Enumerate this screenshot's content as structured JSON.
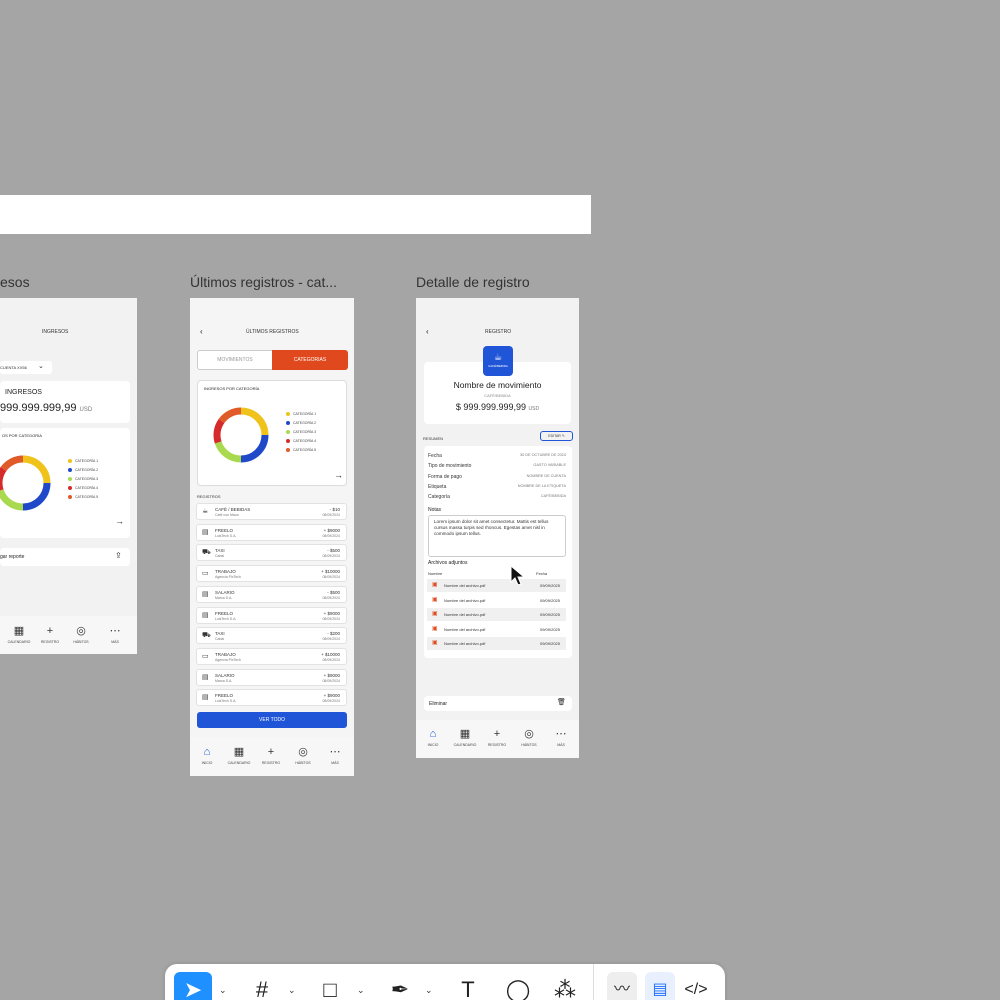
{
  "canvas": {
    "bg": "#a5a5a5"
  },
  "frames": {
    "f1": {
      "title": "esos",
      "header": "INGRESOS",
      "account": "CUENTA XX56",
      "summary_label": "INGRESOS",
      "amount": "999.999.999,99",
      "currency": "USD",
      "chart_title": "OS POR CATEGORIA",
      "legend": [
        "CATEGORÍA 1",
        "CATEGORÍA 2",
        "CATEGORÍA 3",
        "CATEGORÍA 4",
        "CATEGORÍA 5"
      ],
      "export": "gar reporte",
      "nav": [
        "CALENDARIO",
        "REGISTRO",
        "HÁBITOS",
        "MÁS"
      ]
    },
    "f2": {
      "title": "Últimos registros - cat...",
      "header": "ÚLTIMOS REGISTROS",
      "tabs": [
        "MOVIMIENTOS",
        "CATEGORIAS"
      ],
      "chart_title": "INGRESOS POR CATEGORÍA",
      "legend": [
        "CATEGORÍA 1",
        "CATEGORÍA 2",
        "CATEGORÍA 3",
        "CATEGORÍA 4",
        "CATEGORÍA 5"
      ],
      "section": "REGISTROS",
      "rows": [
        {
          "icon": "☕",
          "name": "CAFÉ / BEBIDAS",
          "sub": "Café con Maca",
          "amount": "- $10",
          "date": "08/09/2024"
        },
        {
          "icon": "▤",
          "name": "FREELO",
          "sub": "LuisTech S.A.",
          "amount": "+ $9000",
          "date": "08/09/2024"
        },
        {
          "icon": "⛟",
          "name": "TAXI",
          "sub": "Cabai",
          "amount": "- $500",
          "date": "08/09/2024"
        },
        {
          "icon": "▭",
          "name": "TRABAJO",
          "sub": "Agencia PixTech",
          "amount": "+ $10000",
          "date": "08/09/2024"
        },
        {
          "icon": "▤",
          "name": "SALARIO",
          "sub": "Marca S.A.",
          "amount": "- $500",
          "date": "08/09/2024"
        },
        {
          "icon": "▤",
          "name": "FREELO",
          "sub": "LuisTech S.A.",
          "amount": "+ $9000",
          "date": "08/09/2024"
        },
        {
          "icon": "⛟",
          "name": "TAXI",
          "sub": "Cabai",
          "amount": "- $200",
          "date": "08/09/2024"
        },
        {
          "icon": "▭",
          "name": "TRABAJO",
          "sub": "Agencia PixTech",
          "amount": "+ $10000",
          "date": "08/09/2024"
        },
        {
          "icon": "▤",
          "name": "SALARIO",
          "sub": "Marca S.A.",
          "amount": "+ $9000",
          "date": "08/09/2024"
        },
        {
          "icon": "▤",
          "name": "FREELO",
          "sub": "LuisTech S.A.",
          "amount": "+ $9000",
          "date": "08/09/2024"
        }
      ],
      "cta": "VER TODO",
      "nav": [
        "INICIO",
        "CALENDARIO",
        "REGISTRO",
        "HÁBITOS",
        "MÁS"
      ]
    },
    "f3": {
      "title": "Detalle de registro",
      "header": "REGISTRO",
      "badge": "CAFÉ/BEBIDA",
      "name": "Nombre de movimiento",
      "category": "CAFÉ/BEBIDA",
      "amount": "$ 999.999.999,99",
      "currency": "USD",
      "section": "RESUMEN",
      "edit": "EDITAR",
      "details": [
        {
          "label": "Fecha",
          "value": "30 DE OCTUBRE DE 2024"
        },
        {
          "label": "Tipo de movimiento",
          "value": "GASTO VARIABLE"
        },
        {
          "label": "Forma de pago",
          "value": "NOMBRE DE CUENTA"
        },
        {
          "label": "Etiqueta",
          "value": "NOMBRE DE LA ETIQUETA"
        },
        {
          "label": "Categoría",
          "value": "CAFÉ/BEBIDA"
        }
      ],
      "notes_label": "Notas",
      "notes": "Lorem ipsum dolor sit amet consectetur. Mattis est tellus cursus massa turpis sed rhoncus. Egestas amet nisl in commodo ipsum tellus.",
      "files_label": "Archivos adjuntos",
      "files_col_name": "Nombre",
      "files_col_date": "Fecha",
      "files": [
        {
          "name": "Nombre del archivo.pdf",
          "date": "09/09/2025"
        },
        {
          "name": "Nombre del archivo.pdf",
          "date": "09/09/2025"
        },
        {
          "name": "Nombre del archivo.pdf",
          "date": "09/09/2025"
        },
        {
          "name": "Nombre del archivo.pdf",
          "date": "09/09/2025"
        },
        {
          "name": "Nombre del archivo.pdf",
          "date": "09/09/2025"
        }
      ],
      "delete": "Eliminar",
      "nav": [
        "INICIO",
        "CALENDARIO",
        "REGISTRO",
        "HÁBITOS",
        "MÁS"
      ]
    }
  },
  "chart_data": [
    {
      "type": "pie",
      "categories": [
        "CATEGORÍA 1",
        "CATEGORÍA 2",
        "CATEGORÍA 3",
        "CATEGORÍA 4",
        "CATEGORÍA 5"
      ],
      "values": [
        25,
        25,
        20,
        15,
        15
      ],
      "colors": [
        "#f0c21c",
        "#1f49c9",
        "#a9d94f",
        "#d62b2b",
        "#e05a2a"
      ],
      "title": "INGRESOS POR CATEGORÍA"
    }
  ],
  "colors": {
    "accent": "#e0491e",
    "primary": "#1f55d6"
  }
}
